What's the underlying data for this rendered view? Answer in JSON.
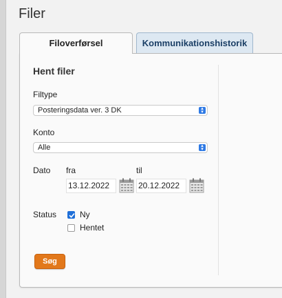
{
  "page_title": "Filer",
  "tabs": [
    {
      "label": "Filoverførsel",
      "active": true
    },
    {
      "label": "Kommunikationshistorik",
      "active": false
    }
  ],
  "form": {
    "title": "Hent filer",
    "filtype": {
      "label": "Filtype",
      "value": "Posteringsdata ver. 3 DK"
    },
    "konto": {
      "label": "Konto",
      "value": "Alle"
    },
    "dato": {
      "label": "Dato",
      "from_label": "fra",
      "from_value": "13.12.2022",
      "to_label": "til",
      "to_value": "20.12.2022"
    },
    "status": {
      "label": "Status",
      "options": [
        {
          "label": "Ny",
          "checked": true
        },
        {
          "label": "Hentet",
          "checked": false
        }
      ]
    },
    "search_label": "Søg"
  },
  "colors": {
    "accent_button": "#e2781b",
    "checkbox_checked": "#1f6fd8",
    "inactive_tab": "#dde8f2",
    "inactive_tab_text": "#1b3f66"
  },
  "icons": [
    "chevron-updown-icon",
    "calendar-icon",
    "checkmark-icon"
  ]
}
